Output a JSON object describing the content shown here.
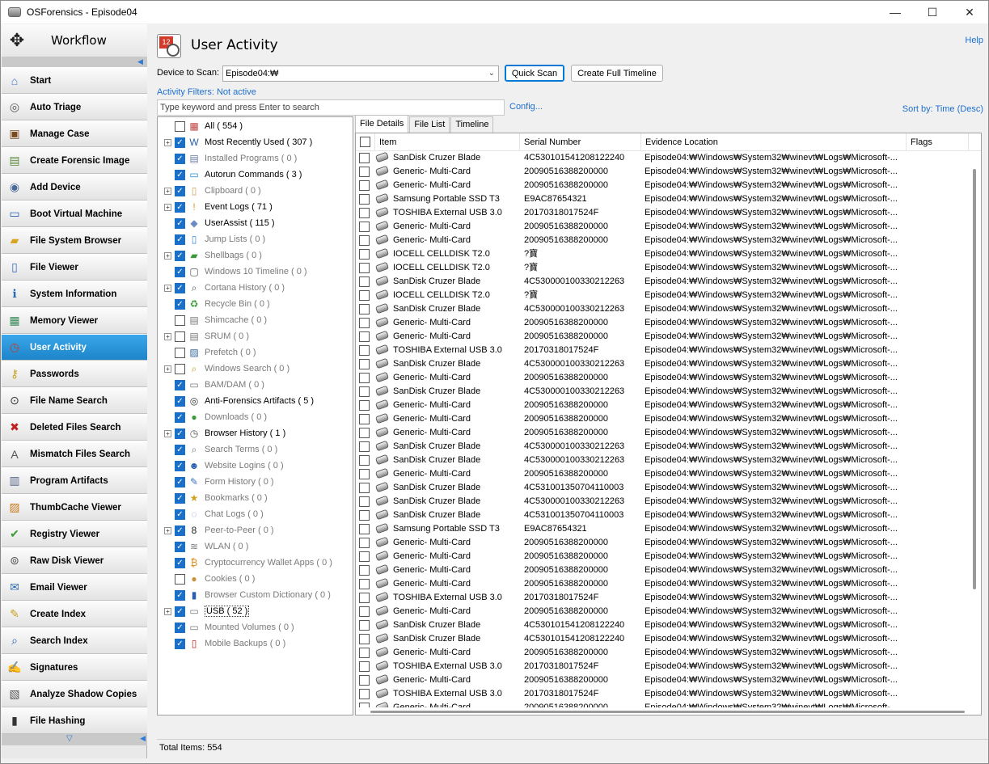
{
  "window": {
    "title": "OSForensics - Episode04",
    "minimize": "—",
    "maximize": "☐",
    "close": "✕"
  },
  "sidebar": {
    "title": "Workflow",
    "items": [
      {
        "label": "Start",
        "icon": "start-icon",
        "glyph": "⌂",
        "color": "#3b7bd0"
      },
      {
        "label": "Auto Triage",
        "icon": "fingerprint-icon",
        "glyph": "◎",
        "color": "#555555"
      },
      {
        "label": "Manage Case",
        "icon": "briefcase-icon",
        "glyph": "▣",
        "color": "#7a4a1e"
      },
      {
        "label": "Create Forensic Image",
        "icon": "drive-image-icon",
        "glyph": "▤",
        "color": "#5a8a3a"
      },
      {
        "label": "Add Device",
        "icon": "add-device-icon",
        "glyph": "◉",
        "color": "#4a6a9a"
      },
      {
        "label": "Boot Virtual Machine",
        "icon": "monitor-icon",
        "glyph": "▭",
        "color": "#2a5fb0"
      },
      {
        "label": "File System Browser",
        "icon": "folder-icon",
        "glyph": "▰",
        "color": "#d9a520"
      },
      {
        "label": "File Viewer",
        "icon": "file-icon",
        "glyph": "▯",
        "color": "#3a6fc0"
      },
      {
        "label": "System Information",
        "icon": "system-info-icon",
        "glyph": "ℹ",
        "color": "#2a6ab0"
      },
      {
        "label": "Memory Viewer",
        "icon": "memory-icon",
        "glyph": "▦",
        "color": "#3a8a5a"
      },
      {
        "label": "User Activity",
        "icon": "user-activity-icon",
        "glyph": "◷",
        "color": "#c83a2a"
      },
      {
        "label": "Passwords",
        "icon": "keys-icon",
        "glyph": "⚷",
        "color": "#c8a020"
      },
      {
        "label": "File Name Search",
        "icon": "binoculars-icon",
        "glyph": "⊙",
        "color": "#333333"
      },
      {
        "label": "Deleted Files Search",
        "icon": "deleted-file-icon",
        "glyph": "✖",
        "color": "#c02020"
      },
      {
        "label": "Mismatch Files Search",
        "icon": "mismatch-icon",
        "glyph": "A",
        "color": "#555555"
      },
      {
        "label": "Program Artifacts",
        "icon": "program-artifacts-icon",
        "glyph": "▥",
        "color": "#5a6a8a"
      },
      {
        "label": "ThumbCache Viewer",
        "icon": "thumbcache-icon",
        "glyph": "▨",
        "color": "#c87a20"
      },
      {
        "label": "Registry Viewer",
        "icon": "registry-icon",
        "glyph": "✔",
        "color": "#3a9a3a"
      },
      {
        "label": "Raw Disk Viewer",
        "icon": "raw-disk-icon",
        "glyph": "⊚",
        "color": "#555555"
      },
      {
        "label": "Email Viewer",
        "icon": "email-icon",
        "glyph": "✉",
        "color": "#2a6ab0"
      },
      {
        "label": "Create Index",
        "icon": "create-index-icon",
        "glyph": "✎",
        "color": "#c8a020"
      },
      {
        "label": "Search Index",
        "icon": "search-index-icon",
        "glyph": "⌕",
        "color": "#2a5fb0"
      },
      {
        "label": "Signatures",
        "icon": "signatures-icon",
        "glyph": "✍",
        "color": "#3a6fc0"
      },
      {
        "label": "Analyze Shadow Copies",
        "icon": "shadow-copies-icon",
        "glyph": "▧",
        "color": "#555555"
      },
      {
        "label": "File Hashing",
        "icon": "hashing-icon",
        "glyph": "▮",
        "color": "#333333"
      }
    ],
    "active_index": 10
  },
  "main": {
    "title": "User Activity",
    "help": "Help",
    "device_label": "Device to Scan:",
    "device_value": "Episode04:₩",
    "quick_scan": "Quick Scan",
    "full_timeline": "Create Full Timeline",
    "filters": "Activity Filters: Not active",
    "search_placeholder": "Type keyword and press Enter to search",
    "config": "Config...",
    "sort_by": "Sort by: Time (Desc)"
  },
  "tree": [
    {
      "label": "All ( 554 )",
      "checked": false,
      "expand": "",
      "dim": false,
      "icon": "all-icon",
      "glyph": "▦",
      "color": "#c04040"
    },
    {
      "label": "Most Recently Used ( 307 )",
      "checked": true,
      "expand": "+",
      "dim": false,
      "icon": "mru-icon",
      "glyph": "W",
      "color": "#2a5fb0"
    },
    {
      "label": "Installed Programs ( 0 )",
      "checked": true,
      "expand": "",
      "dim": true,
      "icon": "programs-icon",
      "glyph": "▤",
      "color": "#6a7aa0"
    },
    {
      "label": "Autorun Commands ( 3 )",
      "checked": true,
      "expand": "",
      "dim": false,
      "icon": "autorun-icon",
      "glyph": "▭",
      "color": "#1a8ad0"
    },
    {
      "label": "Clipboard ( 0 )",
      "checked": true,
      "expand": "+",
      "dim": true,
      "icon": "clipboard-icon",
      "glyph": "▯",
      "color": "#c8a060"
    },
    {
      "label": "Event Logs ( 71 )",
      "checked": true,
      "expand": "+",
      "dim": false,
      "icon": "event-logs-icon",
      "glyph": "!",
      "color": "#d0a020"
    },
    {
      "label": "UserAssist ( 115 )",
      "checked": true,
      "expand": "",
      "dim": false,
      "icon": "userassist-icon",
      "glyph": "◆",
      "color": "#6a8ac0"
    },
    {
      "label": "Jump Lists ( 0 )",
      "checked": true,
      "expand": "",
      "dim": true,
      "icon": "jumplists-icon",
      "glyph": "▯",
      "color": "#3a8ad0"
    },
    {
      "label": "Shellbags ( 0 )",
      "checked": true,
      "expand": "+",
      "dim": true,
      "icon": "shellbags-icon",
      "glyph": "▰",
      "color": "#3a9a3a"
    },
    {
      "label": "Windows 10 Timeline ( 0 )",
      "checked": true,
      "expand": "",
      "dim": true,
      "icon": "timeline-icon",
      "glyph": "▢",
      "color": "#555555"
    },
    {
      "label": "Cortana History ( 0 )",
      "checked": true,
      "expand": "+",
      "dim": true,
      "icon": "cortana-icon",
      "glyph": "⌕",
      "color": "#555555"
    },
    {
      "label": "Recycle Bin ( 0 )",
      "checked": true,
      "expand": "",
      "dim": true,
      "icon": "recycle-bin-icon",
      "glyph": "♻",
      "color": "#3a9a3a"
    },
    {
      "label": "Shimcache ( 0 )",
      "checked": false,
      "expand": "",
      "dim": true,
      "icon": "shimcache-icon",
      "glyph": "▤",
      "color": "#7a7a7a"
    },
    {
      "label": "SRUM ( 0 )",
      "checked": false,
      "expand": "+",
      "dim": true,
      "icon": "srum-icon",
      "glyph": "▤",
      "color": "#7a7a7a"
    },
    {
      "label": "Prefetch ( 0 )",
      "checked": false,
      "expand": "",
      "dim": true,
      "icon": "prefetch-icon",
      "glyph": "▨",
      "color": "#3a6a9a"
    },
    {
      "label": "Windows Search ( 0 )",
      "checked": false,
      "expand": "+",
      "dim": true,
      "icon": "windows-search-icon",
      "glyph": "⌕",
      "color": "#c8a020"
    },
    {
      "label": "BAM/DAM ( 0 )",
      "checked": true,
      "expand": "",
      "dim": true,
      "icon": "bam-icon",
      "glyph": "▭",
      "color": "#7a7a7a"
    },
    {
      "label": "Anti-Forensics Artifacts ( 5 )",
      "checked": true,
      "expand": "",
      "dim": false,
      "icon": "anti-forensics-icon",
      "glyph": "◎",
      "color": "#333333"
    },
    {
      "label": "Downloads ( 0 )",
      "checked": true,
      "expand": "",
      "dim": true,
      "icon": "downloads-icon",
      "glyph": "●",
      "color": "#3a9a3a"
    },
    {
      "label": "Browser History ( 1 )",
      "checked": true,
      "expand": "+",
      "dim": false,
      "icon": "browser-history-icon",
      "glyph": "◷",
      "color": "#555555"
    },
    {
      "label": "Search Terms ( 0 )",
      "checked": true,
      "expand": "",
      "dim": true,
      "icon": "search-terms-icon",
      "glyph": "⌕",
      "color": "#7a7a7a"
    },
    {
      "label": "Website Logins ( 0 )",
      "checked": true,
      "expand": "",
      "dim": true,
      "icon": "website-logins-icon",
      "glyph": "☻",
      "color": "#2a5fb0"
    },
    {
      "label": "Form History ( 0 )",
      "checked": true,
      "expand": "",
      "dim": true,
      "icon": "form-history-icon",
      "glyph": "✎",
      "color": "#3a6fc0"
    },
    {
      "label": "Bookmarks ( 0 )",
      "checked": true,
      "expand": "",
      "dim": true,
      "icon": "bookmarks-icon",
      "glyph": "★",
      "color": "#d0a020"
    },
    {
      "label": "Chat Logs ( 0 )",
      "checked": true,
      "expand": "",
      "dim": true,
      "icon": "chat-logs-icon",
      "glyph": "◌",
      "color": "#7a9ac0"
    },
    {
      "label": "Peer-to-Peer ( 0 )",
      "checked": true,
      "expand": "+",
      "dim": true,
      "icon": "peer-to-peer-icon",
      "glyph": "8",
      "color": "#222222"
    },
    {
      "label": "WLAN ( 0 )",
      "checked": true,
      "expand": "",
      "dim": true,
      "icon": "wlan-icon",
      "glyph": "≋",
      "color": "#7a7a7a"
    },
    {
      "label": "Cryptocurrency Wallet Apps ( 0 )",
      "checked": true,
      "expand": "",
      "dim": true,
      "icon": "bitcoin-icon",
      "glyph": "₿",
      "color": "#e08a1a"
    },
    {
      "label": "Cookies ( 0 )",
      "checked": false,
      "expand": "",
      "dim": true,
      "icon": "cookies-icon",
      "glyph": "●",
      "color": "#c89040"
    },
    {
      "label": "Browser Custom Dictionary ( 0 )",
      "checked": true,
      "expand": "",
      "dim": true,
      "icon": "dictionary-icon",
      "glyph": "▮",
      "color": "#2a5fb0"
    },
    {
      "label": "USB ( 52 )",
      "checked": true,
      "expand": "+",
      "dim": false,
      "selected": true,
      "icon": "usb-icon",
      "glyph": "▭",
      "color": "#7a7a7a"
    },
    {
      "label": "Mounted Volumes ( 0 )",
      "checked": true,
      "expand": "",
      "dim": true,
      "icon": "mounted-volumes-icon",
      "glyph": "▭",
      "color": "#7a7a7a"
    },
    {
      "label": "Mobile Backups ( 0 )",
      "checked": true,
      "expand": "",
      "dim": true,
      "icon": "mobile-backups-icon",
      "glyph": "▯",
      "color": "#c02020"
    }
  ],
  "tabs": [
    "File Details",
    "File List",
    "Timeline"
  ],
  "columns": [
    "Item",
    "Serial Number",
    "Evidence Location",
    "Flags"
  ],
  "rows": [
    {
      "item": "SanDisk Cruzer Blade",
      "serial": "4C530101541208122240",
      "location": "Episode04:₩Windows₩System32₩winevt₩Logs₩Microsoft-..."
    },
    {
      "item": "Generic- Multi-Card",
      "serial": "20090516388200000",
      "location": "Episode04:₩Windows₩System32₩winevt₩Logs₩Microsoft-..."
    },
    {
      "item": "Generic- Multi-Card",
      "serial": "20090516388200000",
      "location": "Episode04:₩Windows₩System32₩winevt₩Logs₩Microsoft-..."
    },
    {
      "item": "Samsung Portable SSD T3",
      "serial": "E9AC87654321",
      "location": "Episode04:₩Windows₩System32₩winevt₩Logs₩Microsoft-..."
    },
    {
      "item": "TOSHIBA External USB 3.0",
      "serial": "20170318017524F",
      "location": "Episode04:₩Windows₩System32₩winevt₩Logs₩Microsoft-..."
    },
    {
      "item": "Generic- Multi-Card",
      "serial": "20090516388200000",
      "location": "Episode04:₩Windows₩System32₩winevt₩Logs₩Microsoft-..."
    },
    {
      "item": "Generic- Multi-Card",
      "serial": "20090516388200000",
      "location": "Episode04:₩Windows₩System32₩winevt₩Logs₩Microsoft-..."
    },
    {
      "item": "IOCELL CELLDISK T2.0",
      "serial": "?寶",
      "location": "Episode04:₩Windows₩System32₩winevt₩Logs₩Microsoft-..."
    },
    {
      "item": "IOCELL CELLDISK T2.0",
      "serial": "?寶",
      "location": "Episode04:₩Windows₩System32₩winevt₩Logs₩Microsoft-..."
    },
    {
      "item": "SanDisk Cruzer Blade",
      "serial": "4C530000100330212263",
      "location": "Episode04:₩Windows₩System32₩winevt₩Logs₩Microsoft-..."
    },
    {
      "item": "IOCELL CELLDISK T2.0",
      "serial": "?寶",
      "location": "Episode04:₩Windows₩System32₩winevt₩Logs₩Microsoft-..."
    },
    {
      "item": "SanDisk Cruzer Blade",
      "serial": "4C530000100330212263",
      "location": "Episode04:₩Windows₩System32₩winevt₩Logs₩Microsoft-..."
    },
    {
      "item": "Generic- Multi-Card",
      "serial": "20090516388200000",
      "location": "Episode04:₩Windows₩System32₩winevt₩Logs₩Microsoft-..."
    },
    {
      "item": "Generic- Multi-Card",
      "serial": "20090516388200000",
      "location": "Episode04:₩Windows₩System32₩winevt₩Logs₩Microsoft-..."
    },
    {
      "item": "TOSHIBA External USB 3.0",
      "serial": "20170318017524F",
      "location": "Episode04:₩Windows₩System32₩winevt₩Logs₩Microsoft-..."
    },
    {
      "item": "SanDisk Cruzer Blade",
      "serial": "4C530000100330212263",
      "location": "Episode04:₩Windows₩System32₩winevt₩Logs₩Microsoft-..."
    },
    {
      "item": "Generic- Multi-Card",
      "serial": "20090516388200000",
      "location": "Episode04:₩Windows₩System32₩winevt₩Logs₩Microsoft-..."
    },
    {
      "item": "SanDisk Cruzer Blade",
      "serial": "4C530000100330212263",
      "location": "Episode04:₩Windows₩System32₩winevt₩Logs₩Microsoft-..."
    },
    {
      "item": "Generic- Multi-Card",
      "serial": "20090516388200000",
      "location": "Episode04:₩Windows₩System32₩winevt₩Logs₩Microsoft-..."
    },
    {
      "item": "Generic- Multi-Card",
      "serial": "20090516388200000",
      "location": "Episode04:₩Windows₩System32₩winevt₩Logs₩Microsoft-..."
    },
    {
      "item": "Generic- Multi-Card",
      "serial": "20090516388200000",
      "location": "Episode04:₩Windows₩System32₩winevt₩Logs₩Microsoft-..."
    },
    {
      "item": "SanDisk Cruzer Blade",
      "serial": "4C530000100330212263",
      "location": "Episode04:₩Windows₩System32₩winevt₩Logs₩Microsoft-..."
    },
    {
      "item": "SanDisk Cruzer Blade",
      "serial": "4C530000100330212263",
      "location": "Episode04:₩Windows₩System32₩winevt₩Logs₩Microsoft-..."
    },
    {
      "item": "Generic- Multi-Card",
      "serial": "20090516388200000",
      "location": "Episode04:₩Windows₩System32₩winevt₩Logs₩Microsoft-..."
    },
    {
      "item": "SanDisk Cruzer Blade",
      "serial": "4C531001350704110003",
      "location": "Episode04:₩Windows₩System32₩winevt₩Logs₩Microsoft-..."
    },
    {
      "item": "SanDisk Cruzer Blade",
      "serial": "4C530000100330212263",
      "location": "Episode04:₩Windows₩System32₩winevt₩Logs₩Microsoft-..."
    },
    {
      "item": "SanDisk Cruzer Blade",
      "serial": "4C531001350704110003",
      "location": "Episode04:₩Windows₩System32₩winevt₩Logs₩Microsoft-..."
    },
    {
      "item": "Samsung Portable SSD T3",
      "serial": "E9AC87654321",
      "location": "Episode04:₩Windows₩System32₩winevt₩Logs₩Microsoft-..."
    },
    {
      "item": "Generic- Multi-Card",
      "serial": "20090516388200000",
      "location": "Episode04:₩Windows₩System32₩winevt₩Logs₩Microsoft-..."
    },
    {
      "item": "Generic- Multi-Card",
      "serial": "20090516388200000",
      "location": "Episode04:₩Windows₩System32₩winevt₩Logs₩Microsoft-..."
    },
    {
      "item": "Generic- Multi-Card",
      "serial": "20090516388200000",
      "location": "Episode04:₩Windows₩System32₩winevt₩Logs₩Microsoft-..."
    },
    {
      "item": "Generic- Multi-Card",
      "serial": "20090516388200000",
      "location": "Episode04:₩Windows₩System32₩winevt₩Logs₩Microsoft-..."
    },
    {
      "item": "TOSHIBA External USB 3.0",
      "serial": "20170318017524F",
      "location": "Episode04:₩Windows₩System32₩winevt₩Logs₩Microsoft-..."
    },
    {
      "item": "Generic- Multi-Card",
      "serial": "20090516388200000",
      "location": "Episode04:₩Windows₩System32₩winevt₩Logs₩Microsoft-..."
    },
    {
      "item": "SanDisk Cruzer Blade",
      "serial": "4C530101541208122240",
      "location": "Episode04:₩Windows₩System32₩winevt₩Logs₩Microsoft-..."
    },
    {
      "item": "SanDisk Cruzer Blade",
      "serial": "4C530101541208122240",
      "location": "Episode04:₩Windows₩System32₩winevt₩Logs₩Microsoft-..."
    },
    {
      "item": "Generic- Multi-Card",
      "serial": "20090516388200000",
      "location": "Episode04:₩Windows₩System32₩winevt₩Logs₩Microsoft-..."
    },
    {
      "item": "TOSHIBA External USB 3.0",
      "serial": "20170318017524F",
      "location": "Episode04:₩Windows₩System32₩winevt₩Logs₩Microsoft-..."
    },
    {
      "item": "Generic- Multi-Card",
      "serial": "20090516388200000",
      "location": "Episode04:₩Windows₩System32₩winevt₩Logs₩Microsoft-..."
    },
    {
      "item": "TOSHIBA External USB 3.0",
      "serial": "20170318017524F",
      "location": "Episode04:₩Windows₩System32₩winevt₩Logs₩Microsoft-..."
    },
    {
      "item": "Generic- Multi-Card",
      "serial": "20090516388200000",
      "location": "Episode04:₩Windows₩System32₩winevt₩Logs₩Microsoft-..."
    }
  ],
  "status": "Total Items: 554"
}
